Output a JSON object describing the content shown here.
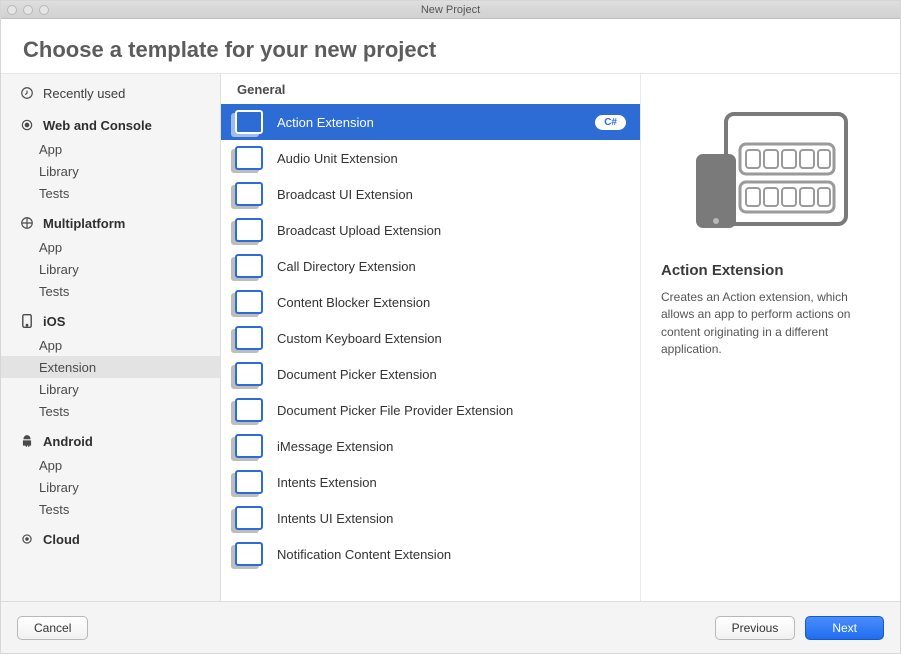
{
  "window": {
    "title": "New Project"
  },
  "page_title": "Choose a template for your new project",
  "sidebar": {
    "recently_used": "Recently used",
    "groups": [
      {
        "label": "Web and Console",
        "icon": "target-icon",
        "items": [
          "App",
          "Library",
          "Tests"
        ]
      },
      {
        "label": "Multiplatform",
        "icon": "platform-icon",
        "items": [
          "App",
          "Library",
          "Tests"
        ]
      },
      {
        "label": "iOS",
        "icon": "phone-icon",
        "items": [
          "App",
          "Extension",
          "Library",
          "Tests"
        ],
        "selected": "Extension"
      },
      {
        "label": "Android",
        "icon": "android-icon",
        "items": [
          "App",
          "Library",
          "Tests"
        ]
      },
      {
        "label": "Cloud",
        "icon": "cloud-icon",
        "items": []
      }
    ]
  },
  "section_header": "General",
  "templates": [
    {
      "label": "Action Extension",
      "lang": "C#",
      "selected": true
    },
    {
      "label": "Audio Unit Extension"
    },
    {
      "label": "Broadcast UI Extension"
    },
    {
      "label": "Broadcast Upload Extension"
    },
    {
      "label": "Call Directory Extension"
    },
    {
      "label": "Content Blocker Extension"
    },
    {
      "label": "Custom Keyboard Extension"
    },
    {
      "label": "Document Picker Extension"
    },
    {
      "label": "Document Picker File Provider Extension"
    },
    {
      "label": "iMessage Extension"
    },
    {
      "label": "Intents Extension"
    },
    {
      "label": "Intents UI Extension"
    },
    {
      "label": "Notification Content Extension"
    }
  ],
  "detail": {
    "name": "Action Extension",
    "description": "Creates an Action extension, which allows an app to perform actions on content originating in a different application."
  },
  "footer": {
    "cancel": "Cancel",
    "previous": "Previous",
    "next": "Next"
  }
}
